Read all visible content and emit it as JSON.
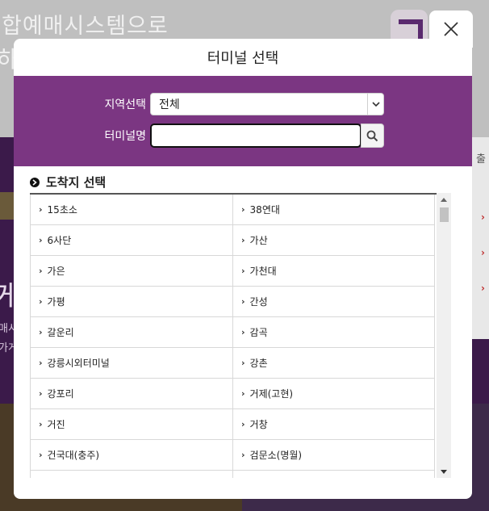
{
  "background": {
    "heading": "합예매시스템으로",
    "heading2": "하",
    "big_text": "게",
    "small1": "매시",
    "small2": "가게",
    "right_text": "출"
  },
  "modal": {
    "title": "터미널 선택",
    "close_icon": "close-icon",
    "region_label": "지역선택",
    "region_value": "전체",
    "name_label": "터미널명",
    "name_value": "",
    "search_icon": "search-icon",
    "section_title": "도착지 선택"
  },
  "terminals": [
    "15초소",
    "38연대",
    "6사단",
    "가산",
    "가은",
    "가천대",
    "가평",
    "간성",
    "갈운리",
    "감곡",
    "강릉시외터미널",
    "강촌",
    "강포리",
    "거제(고현)",
    "거진",
    "거창",
    "건국대(충주)",
    "검문소(명월)",
    "",
    ""
  ],
  "colors": {
    "accent": "#7b3682",
    "overlay": "#3a3a3a"
  }
}
